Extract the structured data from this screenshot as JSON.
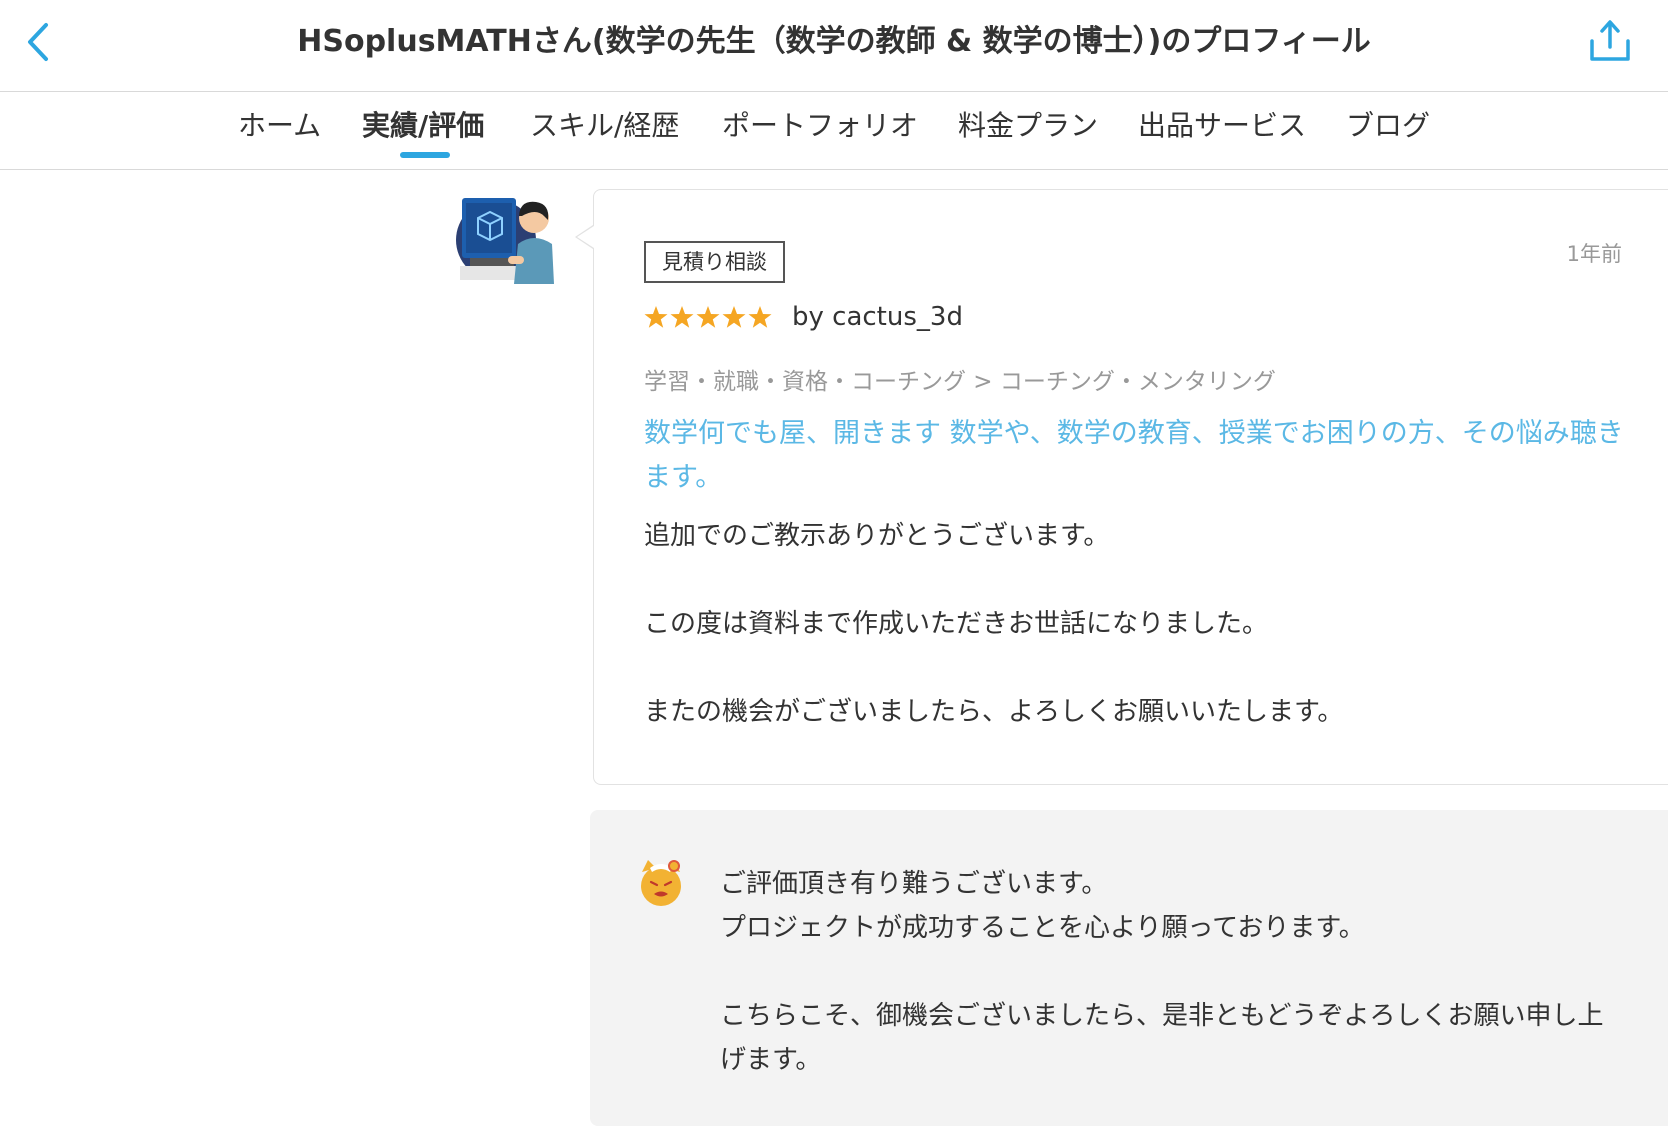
{
  "header": {
    "title": "HSoplusMATHさん(数学の先生（数学の教師 & 数学の博士）)のプロフィール",
    "back_icon": "chevron-left-icon",
    "share_icon": "share-icon",
    "accent_color": "#2da6e0"
  },
  "tabs": [
    {
      "label": "ホーム",
      "active": false
    },
    {
      "label": "実績/評価",
      "active": true
    },
    {
      "label": "スキル/経歴",
      "active": false
    },
    {
      "label": "ポートフォリオ",
      "active": false
    },
    {
      "label": "料金プラン",
      "active": false
    },
    {
      "label": "出品サービス",
      "active": false
    },
    {
      "label": "ブログ",
      "active": false
    }
  ],
  "review": {
    "badge": "見積り相談",
    "time_ago": "1年前",
    "rating": 5,
    "star_color": "#f5a623",
    "reviewer": "by cactus_3d",
    "category": "学習・就職・資格・コーチング > コーチング・メンタリング",
    "service_title": "数学何でも屋、開きます 数学や、数学の教育、授業でお困りの方、その悩み聴きます。",
    "service_link_color": "#5bb8e5",
    "body": [
      "追加でのご教示ありがとうございます。",
      "この度は資料まで作成いただきお世話になりました。",
      "またの機会がございましたら、よろしくお願いいたします。"
    ]
  },
  "reply": {
    "lines": [
      "ご評価頂き有り難うございます。\nプロジェクトが成功することを心より願っております。",
      "こちらこそ、御機会ございましたら、是非ともどうぞよろしくお願い申し上げます。"
    ]
  }
}
